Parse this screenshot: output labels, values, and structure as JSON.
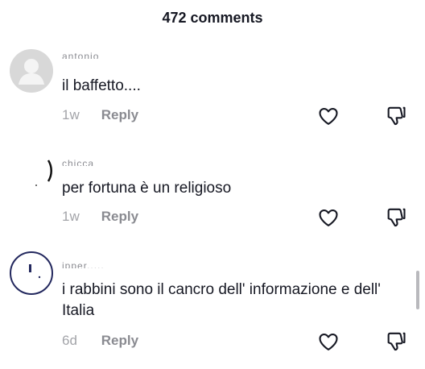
{
  "header": {
    "title": "472 comments"
  },
  "comments": [
    {
      "username": "antonio_____",
      "text": "il baffetto....",
      "time": "1w",
      "reply_label": "Reply"
    },
    {
      "username": "chicca",
      "text": "per fortuna è un religioso",
      "time": "1w",
      "reply_label": "Reply"
    },
    {
      "username": "ipper.....",
      "text": "i rabbini sono il cancro dell' informazione e dell' Italia",
      "time": "6d",
      "reply_label": "Reply"
    }
  ],
  "icons": {
    "like": "heart-outline-icon",
    "dislike": "thumbs-down-outline-icon"
  },
  "colors": {
    "text": "#161823",
    "secondary": "#8a8b91",
    "avatar_ring": "#23285e"
  }
}
